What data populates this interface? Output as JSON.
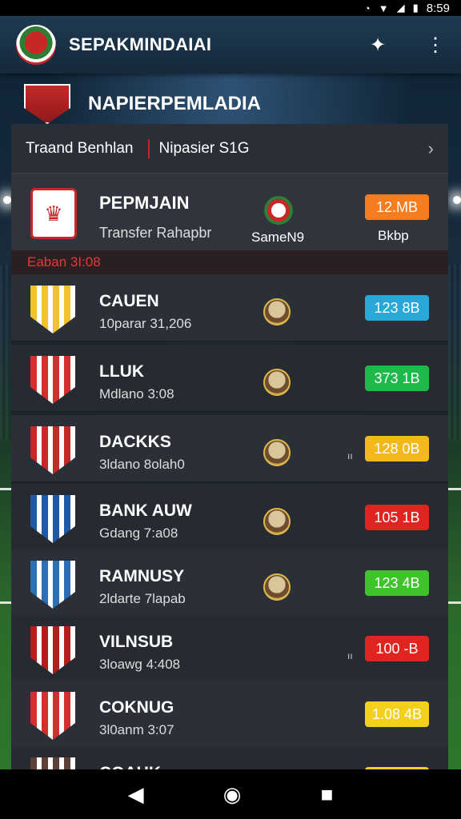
{
  "status_bar": {
    "time": "8:59"
  },
  "app_bar": {
    "title": "SEPAKMINDAIAI"
  },
  "banner": {
    "title": "NAPIERPEMLADIA"
  },
  "filter": {
    "left": "Traand Benhlan",
    "right": "Nipasier S1G"
  },
  "featured": {
    "name": "PEPMJAIN",
    "sub": "Transfer Rahapbr",
    "mini_label": "SameN9",
    "badge": "12.MB",
    "badge_color": "#f57c1f",
    "badge_caption": "Bkbp",
    "date_label": "Eaban 3I:08"
  },
  "rows": [
    {
      "name": "CAUEN",
      "sub": "10parar 31,206",
      "badge": "123 8B",
      "badge_color": "#29a8d8",
      "crest_color": "#f2c12e",
      "dot": ""
    },
    {
      "name": "LLUK",
      "sub": "Mdlano  3:08",
      "badge": "373 1B",
      "badge_color": "#1fb84a",
      "crest_color": "#d32f2f",
      "dot": ""
    },
    {
      "name": "DACKKS",
      "sub": "3ldano  8olah0",
      "badge": "128 0B",
      "badge_color": "#f2b81c",
      "crest_color": "#c62828",
      "dot": "ıı"
    },
    {
      "name": "BANK AUW",
      "sub": "Gdang  7:a08",
      "badge": "105 1B",
      "badge_color": "#e0241f",
      "crest_color": "#1e5aa8",
      "dot": ""
    },
    {
      "name": "RAMNUSY",
      "sub": "2ldarte  7lapab",
      "badge": "123 4B",
      "badge_color": "#3ec32a",
      "crest_color": "#2d6fb5",
      "dot": ""
    },
    {
      "name": "VILNSUB",
      "sub": "3loawg  4:408",
      "badge": "100 -B",
      "badge_color": "#e0241f",
      "crest_color": "#b71c1c",
      "dot": "ıı"
    },
    {
      "name": "COKNUG",
      "sub": "3l0anm  3:07",
      "badge": "1.08 4B",
      "badge_color": "#f2d01c",
      "crest_color": "#d32f2f",
      "dot": ""
    },
    {
      "name": "COAUK",
      "sub": "",
      "badge": "",
      "badge_color": "#f2d01c",
      "crest_color": "#5d4037",
      "dot": ""
    }
  ]
}
